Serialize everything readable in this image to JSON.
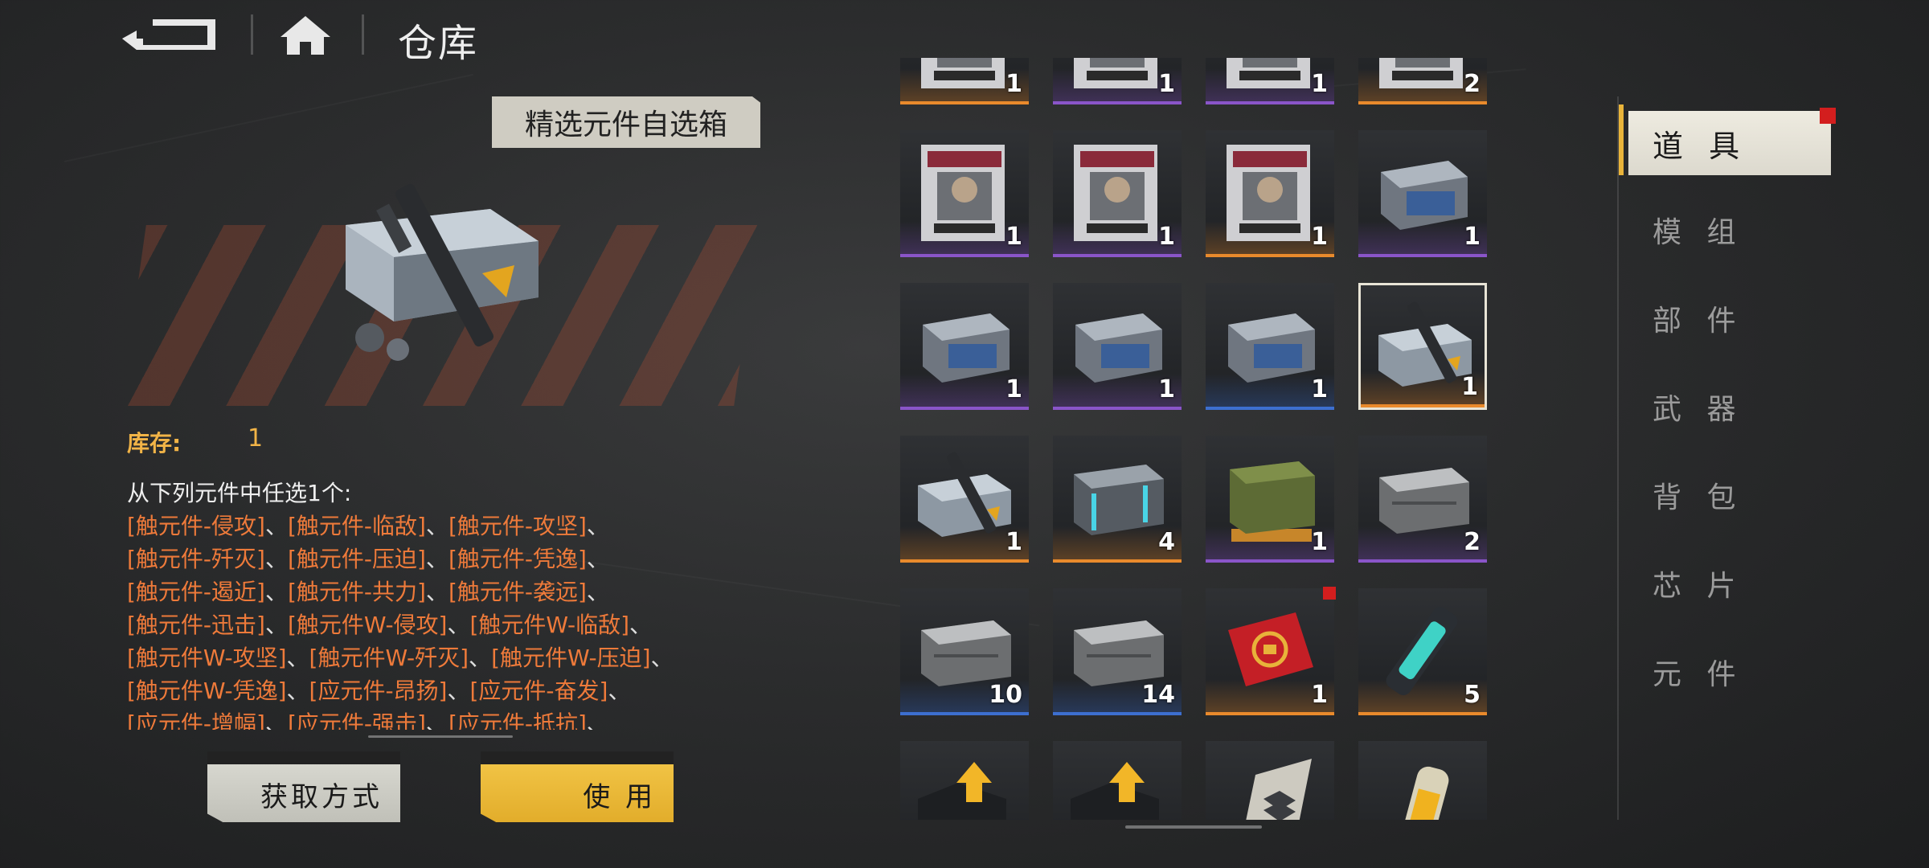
{
  "header": {
    "title": "仓库",
    "back_icon": "back-arrow-icon",
    "home_icon": "home-icon"
  },
  "detail": {
    "item_name": "精选元件自选箱",
    "stock_label": "库存:",
    "stock_value": "1",
    "description_intro": "从下列元件中任选1个:",
    "options": [
      "[触元件-侵攻]",
      "[触元件-临敌]",
      "[触元件-攻坚]",
      "[触元件-歼灭]",
      "[触元件-压迫]",
      "[触元件-凭逸]",
      "[触元件-遏近]",
      "[触元件-共力]",
      "[触元件-袭远]",
      "[触元件-迅击]",
      "[触元件W-侵攻]",
      "[触元件W-临敌]",
      "[触元件W-攻坚]",
      "[触元件W-歼灭]",
      "[触元件W-压迫]",
      "[触元件W-凭逸]",
      "[应元件-昂扬]",
      "[应元件-奋发]",
      "[应元件-增幅]",
      "[应元件-强击]",
      "[应元件-抵抗]"
    ],
    "separator": "、",
    "buttons": {
      "obtain": "获取方式",
      "use": "使 用"
    }
  },
  "grid": {
    "rows": [
      {
        "items": [
          {
            "icon": "wanted-poster-icon",
            "count": "1",
            "rarity": "orange"
          },
          {
            "icon": "wanted-poster-icon",
            "count": "1",
            "rarity": "purple"
          },
          {
            "icon": "wanted-poster-icon",
            "count": "1",
            "rarity": "purple"
          },
          {
            "icon": "wanted-poster-icon",
            "count": "2",
            "rarity": "orange"
          }
        ]
      },
      {
        "items": [
          {
            "icon": "wanted-poster-icon",
            "count": "1",
            "rarity": "purple"
          },
          {
            "icon": "wanted-poster-icon",
            "count": "1",
            "rarity": "purple"
          },
          {
            "icon": "wanted-poster-icon",
            "count": "1",
            "rarity": "orange"
          },
          {
            "icon": "metal-crate-icon",
            "count": "1",
            "rarity": "purple"
          }
        ]
      },
      {
        "items": [
          {
            "icon": "metal-crate-icon",
            "count": "1",
            "rarity": "purple"
          },
          {
            "icon": "metal-crate-icon",
            "count": "1",
            "rarity": "purple"
          },
          {
            "icon": "metal-crate-icon",
            "count": "1",
            "rarity": "blue"
          },
          {
            "icon": "weapon-crate-icon",
            "count": "1",
            "rarity": "orange",
            "selected": true
          }
        ]
      },
      {
        "items": [
          {
            "icon": "weapon-crate-icon",
            "count": "1",
            "rarity": "orange"
          },
          {
            "icon": "supply-crate-icon",
            "count": "4",
            "rarity": "orange"
          },
          {
            "icon": "green-crate-icon",
            "count": "1",
            "rarity": "purple"
          },
          {
            "icon": "gray-crate-icon",
            "count": "2",
            "rarity": "purple"
          }
        ]
      },
      {
        "items": [
          {
            "icon": "gray-crate-icon",
            "count": "10",
            "rarity": "blue"
          },
          {
            "icon": "gray-crate-icon",
            "count": "14",
            "rarity": "blue"
          },
          {
            "icon": "red-envelope-icon",
            "count": "1",
            "rarity": "orange",
            "badge": true
          },
          {
            "icon": "energy-canister-icon",
            "count": "5",
            "rarity": "orange"
          }
        ]
      },
      {
        "items": [
          {
            "icon": "upgrade-part-icon",
            "count": "",
            "rarity": "none"
          },
          {
            "icon": "upgrade-part-icon",
            "count": "",
            "rarity": "none"
          },
          {
            "icon": "rank-badge-icon",
            "count": "",
            "rarity": "none"
          },
          {
            "icon": "grenade-icon",
            "count": "",
            "rarity": "none"
          }
        ]
      }
    ]
  },
  "tabs": {
    "active": "道 具",
    "items": [
      "模 组",
      "部 件",
      "武 器",
      "背 包",
      "芯 片",
      "元 件"
    ]
  },
  "colors": {
    "orange": "#e98a2c",
    "purple": "#8a55c9",
    "blue": "#3d6fd0",
    "accent": "#e9b43a",
    "option_text": "#ee7a3a",
    "stock": "#f2b447"
  }
}
